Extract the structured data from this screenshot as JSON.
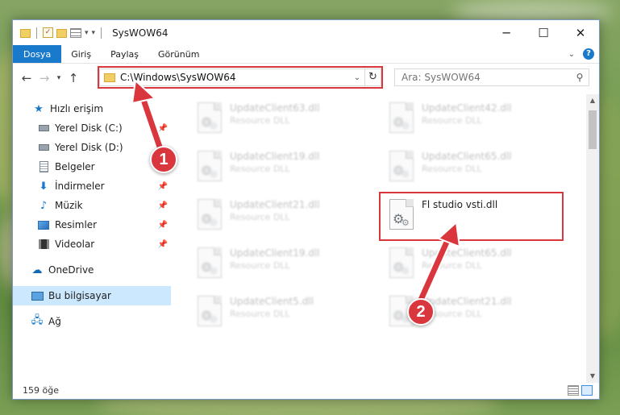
{
  "window": {
    "title": "SysWOW64"
  },
  "ribbon": {
    "tabs": [
      {
        "label": "Dosya",
        "file": true
      },
      {
        "label": "Giriş"
      },
      {
        "label": "Paylaş"
      },
      {
        "label": "Görünüm"
      }
    ],
    "help": "?"
  },
  "address": {
    "path": "C:\\Windows\\SysWOW64"
  },
  "search": {
    "placeholder": "Ara: SysWOW64"
  },
  "sidebar": {
    "items": [
      {
        "label": "Hızlı erişim",
        "icon": "star-icon",
        "pinned": false,
        "selected": false
      },
      {
        "label": "Yerel Disk (C:)",
        "icon": "disk-icon",
        "pinned": true,
        "selected": false
      },
      {
        "label": "Yerel Disk (D:)",
        "icon": "disk-icon",
        "pinned": false,
        "selected": false
      },
      {
        "label": "Belgeler",
        "icon": "documents-icon",
        "pinned": false,
        "selected": false
      },
      {
        "label": "İndirmeler",
        "icon": "download-icon",
        "pinned": true,
        "selected": false
      },
      {
        "label": "Müzik",
        "icon": "music-icon",
        "pinned": true,
        "selected": false
      },
      {
        "label": "Resimler",
        "icon": "pictures-icon",
        "pinned": true,
        "selected": false
      },
      {
        "label": "Videolar",
        "icon": "videos-icon",
        "pinned": true,
        "selected": false
      },
      {
        "label": "OneDrive",
        "icon": "cloud-icon",
        "pinned": false,
        "selected": false
      },
      {
        "label": "Bu bilgisayar",
        "icon": "computer-icon",
        "pinned": false,
        "selected": true
      },
      {
        "label": "Ağ",
        "icon": "network-icon",
        "pinned": false,
        "selected": false
      }
    ]
  },
  "files": [
    {
      "name": "UpdateClient63.dll",
      "type": "Resource DLL",
      "focus": false
    },
    {
      "name": "UpdateClient42.dll",
      "type": "Resource DLL",
      "focus": false
    },
    {
      "name": "UpdateClient19.dll",
      "type": "Resource DLL",
      "focus": false
    },
    {
      "name": "UpdateClient65.dll",
      "type": "Resource DLL",
      "focus": false
    },
    {
      "name": "UpdateClient21.dll",
      "type": "Resource DLL",
      "focus": false
    },
    {
      "name": "Fl studio vsti.dll",
      "type": "",
      "focus": true
    },
    {
      "name": "UpdateClient19.dll",
      "type": "Resource DLL",
      "focus": false
    },
    {
      "name": "UpdateClient65.dll",
      "type": "Resource DLL",
      "focus": false
    },
    {
      "name": "UpdateClient5.dll",
      "type": "Resource DLL",
      "focus": false
    },
    {
      "name": "UpdateClient21.dll",
      "type": "Resource DLL",
      "focus": false
    }
  ],
  "status": {
    "count": "159 öğe"
  },
  "annotations": {
    "step1": "1",
    "step2": "2",
    "color": "#d9363e"
  }
}
